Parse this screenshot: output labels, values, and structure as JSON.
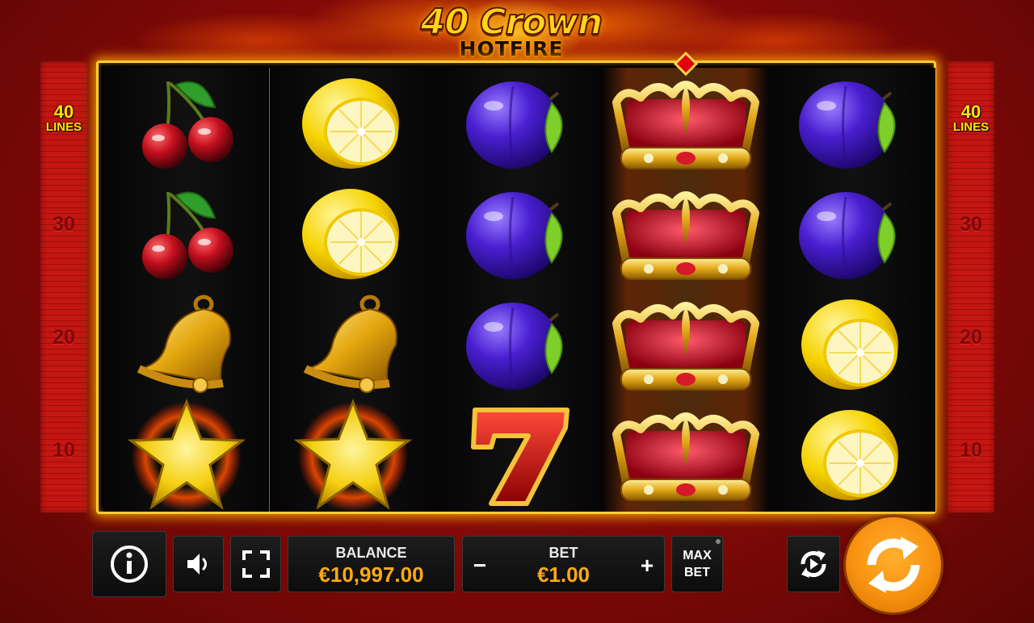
{
  "game": {
    "title_main": "40 Crown",
    "title_sub": "HOTFIRE"
  },
  "lines": {
    "total_number": "40",
    "total_label": "LINES",
    "markers": [
      "30",
      "20",
      "10"
    ]
  },
  "reels": [
    [
      "cherry",
      "cherry",
      "bell",
      "star"
    ],
    [
      "lemon",
      "lemon",
      "bell",
      "star"
    ],
    [
      "plum",
      "plum",
      "plum",
      "seven"
    ],
    [
      "crown",
      "crown",
      "crown",
      "crown"
    ],
    [
      "plum",
      "plum",
      "lemon",
      "lemon"
    ]
  ],
  "controls": {
    "info_icon": "info-icon",
    "sound_icon": "speaker-icon",
    "fullscreen_icon": "fullscreen-icon",
    "balance_label": "BALANCE",
    "balance_value": "€10,997.00",
    "bet_label": "BET",
    "bet_value": "€1.00",
    "bet_minus": "−",
    "bet_plus": "+",
    "max_bet_line1": "MAX",
    "max_bet_line2": "BET",
    "autoplay_icon": "autoplay-icon",
    "spin_icon": "spin-icon"
  },
  "colors": {
    "background": "#9e0e0b",
    "frame_glow": "#ffcc33",
    "value_text": "#ffa914",
    "lines_text": "#ffe600",
    "spin_button": "#f79210"
  }
}
